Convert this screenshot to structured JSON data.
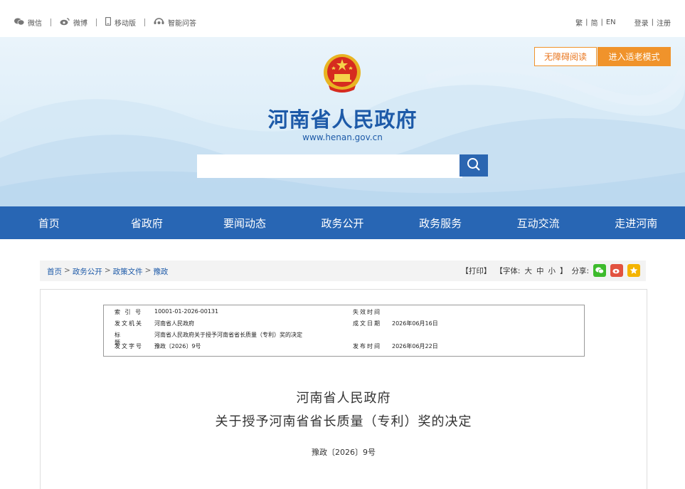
{
  "topbar": {
    "links": [
      {
        "label": "微信",
        "icon": "wechat-icon"
      },
      {
        "label": "微博",
        "icon": "weibo-icon"
      },
      {
        "label": "移动版",
        "icon": "mobile-icon"
      },
      {
        "label": "智能问答",
        "icon": "chat-icon"
      }
    ],
    "lang": {
      "trad": "繁",
      "simp": "简",
      "en": "EN",
      "sep": "|"
    },
    "login": "登录",
    "register": "注册"
  },
  "header": {
    "title": "河南省人民政府",
    "url": "www.henan.gov.cn",
    "access_label": "无障碍阅读",
    "elder_label": "进入适老模式",
    "search_placeholder": ""
  },
  "nav": {
    "items": [
      "首页",
      "省政府",
      "要闻动态",
      "政务公开",
      "政务服务",
      "互动交流",
      "走进河南"
    ]
  },
  "breadcrumb": {
    "items": [
      "首页",
      "政务公开",
      "政策文件",
      "豫政"
    ],
    "sep": ">"
  },
  "tools": {
    "print": "【打印】",
    "font": "【字体:",
    "big": "大",
    "mid": "中",
    "small": "小",
    "font_end": "】",
    "share": "分享:"
  },
  "meta": {
    "index_label": "索 引 号",
    "index_value": "10001-01-2026-00131",
    "expire_label": "失效时间",
    "expire_value": "",
    "issuer_label": "发文机关",
    "issuer_value": "河南省人民政府",
    "created_label": "成文日期",
    "created_value": "2026年06月16日",
    "subject_label": "标 题",
    "subject_value": "河南省人民政府关于授予河南省省长质量（专利）奖的决定",
    "docno_label": "发文字号",
    "docno_value": "豫政〔2026〕9号",
    "published_label": "发布时间",
    "published_value": "2026年06月22日"
  },
  "document": {
    "title_line1": "河南省人民政府",
    "title_line2": "关于授予河南省省长质量（专利）奖的决定",
    "doc_number": "豫政〔2026〕9号"
  },
  "colors": {
    "nav_bg": "#2866b4",
    "title_blue": "#1d5aa8",
    "orange": "#f0932b",
    "wechat_green": "#3dbb2c",
    "weibo_red": "#e2523f",
    "favorite_yellow": "#f4b400"
  }
}
